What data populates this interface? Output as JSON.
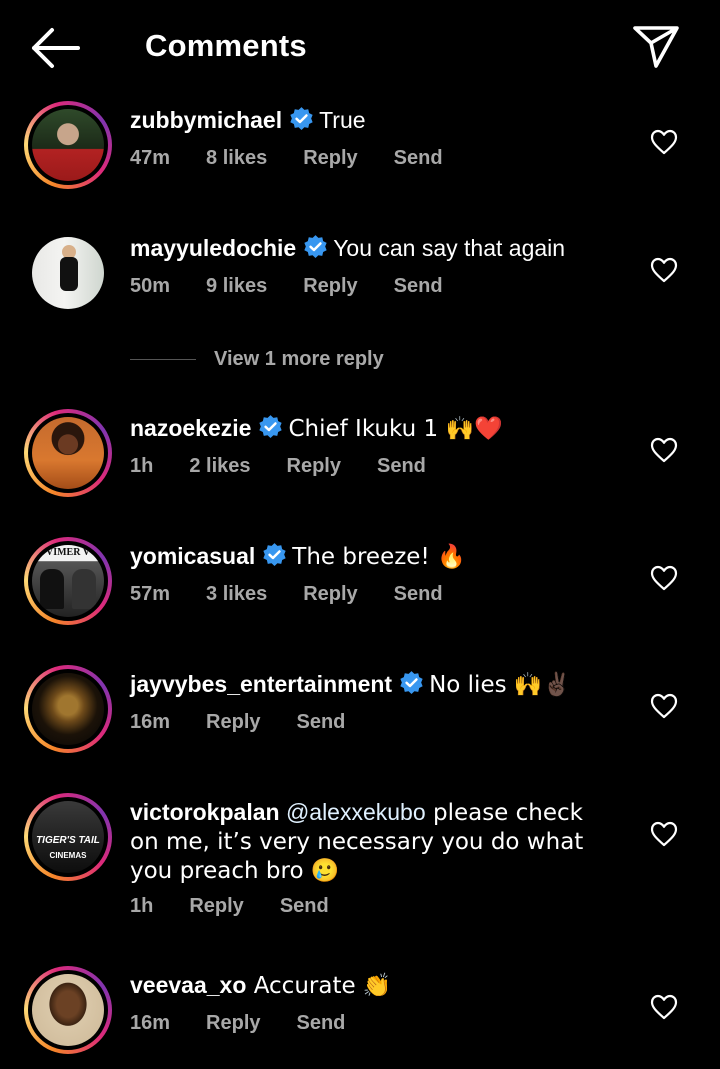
{
  "header": {
    "title": "Comments",
    "back_icon": "arrow-left-icon",
    "share_icon": "paper-plane-icon"
  },
  "colors": {
    "background": "#000000",
    "verified_badge": "#3897f0",
    "meta_text": "#a8a8a8",
    "mention": "#e0f1ff"
  },
  "comments": [
    {
      "username": "zubbymichael",
      "verified": true,
      "text": "True",
      "time": "47m",
      "likes": "8 likes",
      "reply": "Reply",
      "send": "Send"
    },
    {
      "username": "mayyuledochie",
      "verified": true,
      "text": "You can say that again",
      "time": "50m",
      "likes": "9 likes",
      "reply": "Reply",
      "send": "Send"
    },
    {
      "username": "nazoekezie",
      "verified": true,
      "text": "Chief Ikuku 1 🙌❤️",
      "time": "1h",
      "likes": "2 likes",
      "reply": "Reply",
      "send": "Send"
    },
    {
      "username": "yomicasual",
      "verified": true,
      "text": "The breeze! 🔥",
      "time": "57m",
      "likes": "3 likes",
      "reply": "Reply",
      "send": "Send"
    },
    {
      "username": "jayvybes_entertainment",
      "verified": true,
      "text": "No lies 🙌✌🏿",
      "time": "16m",
      "reply": "Reply",
      "send": "Send"
    },
    {
      "username": "victorokpalan",
      "verified": false,
      "mention": "@alexxekubo",
      "text": " please check on me, it’s very necessary you do what you preach bro 🥲",
      "time": "1h",
      "reply": "Reply",
      "send": "Send",
      "avatar_caption": "TIGER'S TAIL"
    },
    {
      "username": "veevaa_xo",
      "verified": false,
      "text": " Accurate 👏",
      "time": "16m",
      "reply": "Reply",
      "send": "Send"
    }
  ],
  "view_more": {
    "label": "View 1 more reply"
  },
  "avatar_texts": {
    "yomicasual": "VIMER V",
    "victor_sub": "CINEMAS"
  }
}
